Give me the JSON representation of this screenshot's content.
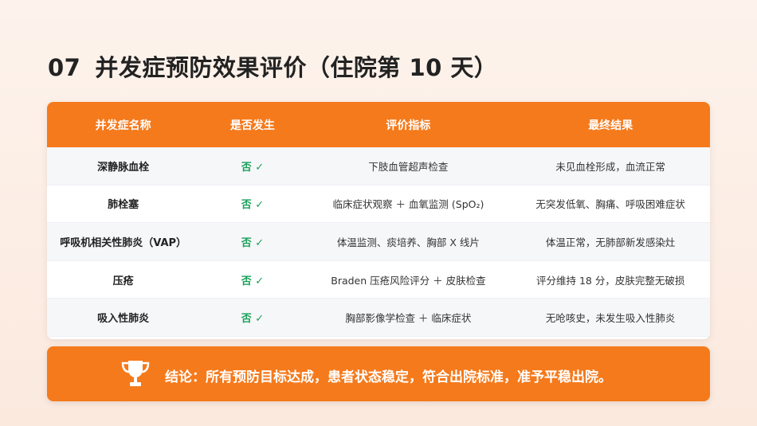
{
  "title": {
    "number": "07",
    "text": "并发症预防效果评价（住院第 10 天）"
  },
  "table": {
    "headers": [
      "并发症名称",
      "是否发生",
      "评价指标",
      "最终结果"
    ],
    "rows": [
      {
        "name": "深静脉血栓",
        "status": "否 ✓",
        "indicator": "下肢血管超声检查",
        "result": "未见血栓形成，血流正常"
      },
      {
        "name": "肺栓塞",
        "status": "否 ✓",
        "indicator": "临床症状观察 ＋ 血氧监测 (SpO₂)",
        "result": "无突发低氧、胸痛、呼吸困难症状"
      },
      {
        "name": "呼吸机相关性肺炎（VAP）",
        "status": "否 ✓",
        "indicator": "体温监测、痰培养、胸部 X 线片",
        "result": "体温正常，无肺部新发感染灶"
      },
      {
        "name": "压疮",
        "status": "否 ✓",
        "indicator": "Braden 压疮风险评分 ＋ 皮肤检查",
        "result": "评分维持 18 分，皮肤完整无破损"
      },
      {
        "name": "吸入性肺炎",
        "status": "否 ✓",
        "indicator": "胸部影像学检查 ＋ 临床症状",
        "result": "无呛咳史，未发生吸入性肺炎"
      }
    ]
  },
  "conclusion": {
    "icon": "trophy-icon",
    "text": "结论：所有预防目标达成，患者状态稳定，符合出院标准，准予平稳出院。"
  },
  "colors": {
    "accent": "#f57a1c",
    "success": "#1aa05a"
  }
}
